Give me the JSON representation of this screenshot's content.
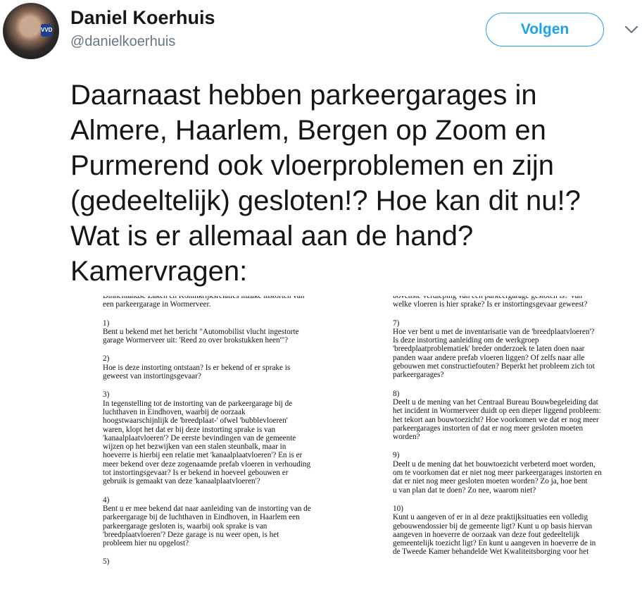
{
  "user": {
    "name": "Daniel Koerhuis",
    "handle": "@danielkoerhuis",
    "avatar_badge": "VVD"
  },
  "follow_button": "Volgen",
  "tweet_text": "Daarnaast hebben parkeergarages in\nAlmere, Haarlem, Bergen op Zoom en\nPurmerend ook vloerproblemen en zijn\n(gedeeltelijk) gesloten!? Hoe kan dit nu!?\nWat is er allemaal aan de hand?\nKamervragen:",
  "document": {
    "left": [
      {
        "num": "",
        "text": "Binnenlandse Zaken en Koninkrijksrelaties inzake instorten van\neen parkeergarage in Wormerveer."
      },
      {
        "num": "1)",
        "text": "Bent u bekend met het bericht \"Automobilist vlucht ingestorte\ngarage Wormerveer uit: 'Reed zo over brokstukken heen'\"?"
      },
      {
        "num": "2)",
        "text": "Hoe is deze instorting ontstaan? Is er bekend of er sprake is\ngeweest van instortingsgevaar?"
      },
      {
        "num": "3)",
        "text": "In tegenstelling tot de instorting van de parkeergarage bij de\nluchthaven in Eindhoven, waarbij de oorzaak\nhoogstwaarschijnlijk de 'breedplaat-' ofwel 'bubblevloeren'\nwaren, klopt het dat er bij deze instorting sprake is van\n'kanaalplaatvloeren'? De eerste bevindingen van de gemeente\nwijzen op het bezwijken van een stalen steunbalk, maar in\nhoeverre is hierbij een relatie met 'kanaalplaatvloeren'? En is er\nmeer bekend over deze zogenaamde prefab vloeren in verhouding\ntot instortingsgevaar? Is er bekend in hoeveel gebouwen er\ngebruik is gemaakt van deze 'kanaalplaatvloeren'?"
      },
      {
        "num": "4)",
        "text": "Bent u er mee bekend dat naar aanleiding van de instorting van de\nparkeergarage bij de luchthaven in Eindhoven, in Haarlem een\nparkeergarage gesloten is, waarbij ook sprake is van\n'breedplaatvloeren'? Deze garage is nu weer open, is het\nprobleem hier nu opgelost?"
      },
      {
        "num": "5)",
        "text": ""
      }
    ],
    "right": [
      {
        "num": "",
        "text": "bovenste verdieping van een parkeergarage gesloten is? Van\nwelke vloeren is hier sprake? Is er instortingsgevaar geweest?"
      },
      {
        "num": "7)",
        "text": "Hoe ver bent u met de inventarisatie van de 'breedplaatvloeren'?\nIs deze instorting aanleiding om de werkgroep\n'breedplaatproblematiek' breder onderzoek te laten doen naar\npanden waar andere prefab vloeren liggen? Of zelfs naar alle\ngebouwen met constructiefouten? Beperkt het probleem zich tot\nparkeergarages?"
      },
      {
        "num": "8)",
        "text": "Deelt u de mening van het Centraal Bureau Bouwbegeleiding dat\nhet incident in Wormerveer duidt op een dieper liggend probleem:\nhet tekort aan bouwtoezicht? Hoe voorkomen we dat er nog meer\nparkeergarages instorten of dat er nog meer gesloten moeten\nworden?"
      },
      {
        "num": "9)",
        "text": "Deelt u de mening dat het bouwtoezicht verbeterd moet worden,\nom te voorkomen dat er niet nog meer parkeergarages instorten en\ndat er niet nog meer gesloten moeten worden? Zo ja, hoe bent\nu van plan dat te doen? Zo nee, waarom niet?"
      },
      {
        "num": "10)",
        "text": "Kunt u aangeven of er in al deze praktijksituaties een volledig\ngebouwendossier bij de gemeente ligt? Kunt u op basis hiervan\naangeven in hoeverre de oorzaak van deze fout gedeeltelijk\ngemeentelijk toezicht ligt? En kunt u aangeven in hoeverre de in\nde Tweede Kamer behandelde Wet Kwaliteitsborging voor het"
      }
    ]
  }
}
